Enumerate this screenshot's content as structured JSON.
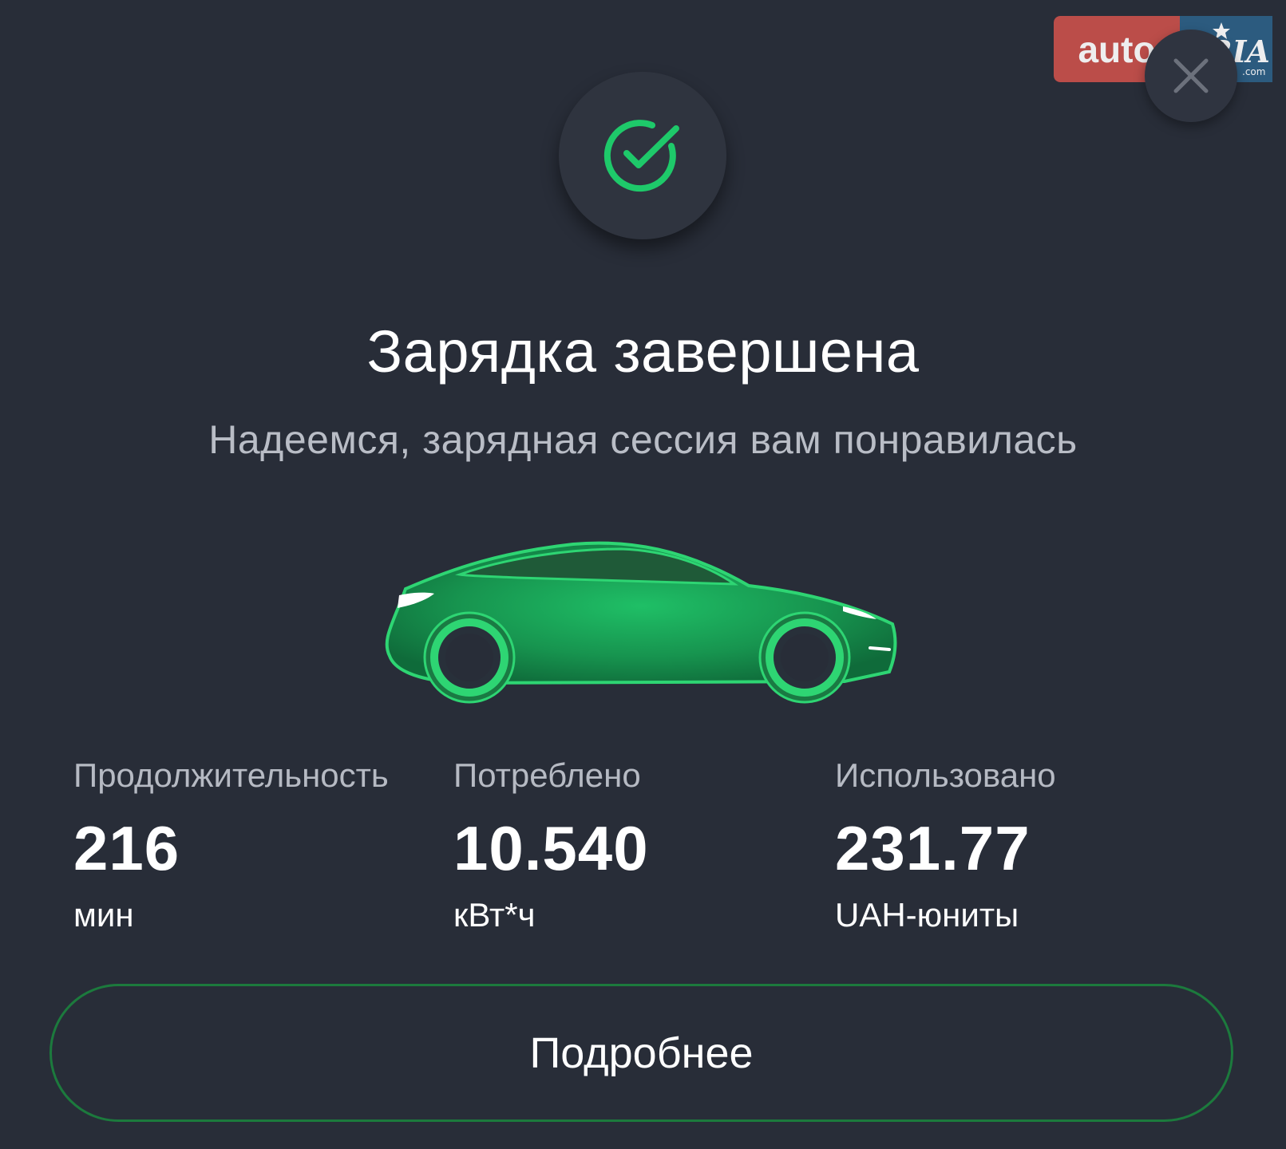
{
  "watermark": {
    "left_text": "auto",
    "right_text": "RIA",
    "domain_text": ".com"
  },
  "header": {
    "close_icon": "close-icon",
    "status_icon": "check-circle-icon"
  },
  "main": {
    "title": "Зарядка завершена",
    "subtitle": "Надеемся, зарядная сессия вам понравилась",
    "illustration": "car-icon"
  },
  "stats": [
    {
      "label": "Продолжительность",
      "value": "216",
      "unit": "мин"
    },
    {
      "label": "Потреблено",
      "value": "10.540",
      "unit": "кВт*ч"
    },
    {
      "label": "Использовано",
      "value": "231.77",
      "unit": "UAH-юниты"
    }
  ],
  "footer": {
    "details_label": "Подробнее"
  },
  "colors": {
    "background": "#282d38",
    "accent_green": "#1ec96a",
    "button_border": "#1c7a3d",
    "muted_text": "#b9bdc6"
  }
}
